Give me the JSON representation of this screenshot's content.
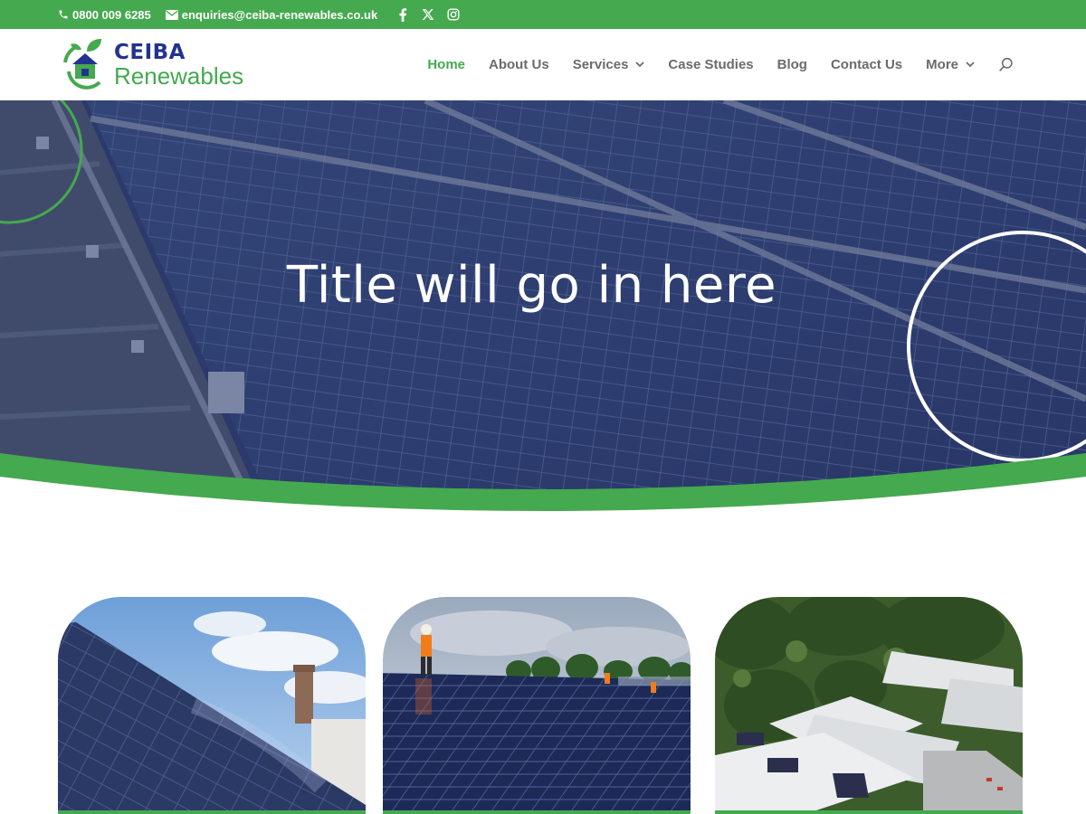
{
  "topbar": {
    "phone": "0800 009 6285",
    "email": "enquiries@ceiba-renewables.co.uk",
    "social": [
      "facebook-icon",
      "x-icon",
      "instagram-icon"
    ]
  },
  "logo": {
    "line1": "CEIBA",
    "line2": "Renewables"
  },
  "nav": {
    "items": [
      {
        "label": "Home",
        "active": true
      },
      {
        "label": "About Us"
      },
      {
        "label": "Services",
        "dropdown": true
      },
      {
        "label": "Case Studies"
      },
      {
        "label": "Blog"
      },
      {
        "label": "Contact Us"
      },
      {
        "label": "More",
        "dropdown": true
      }
    ],
    "search_icon": "search-icon"
  },
  "hero": {
    "title": "Title will go in here"
  },
  "cards": [
    {
      "image": "solar-roof-residential"
    },
    {
      "image": "workers-on-solar-roof"
    },
    {
      "image": "aerial-industrial-buildings"
    }
  ],
  "colors": {
    "brand_green": "#45a94f",
    "brand_blue": "#22338f",
    "nav_text": "#6b6b6b"
  }
}
